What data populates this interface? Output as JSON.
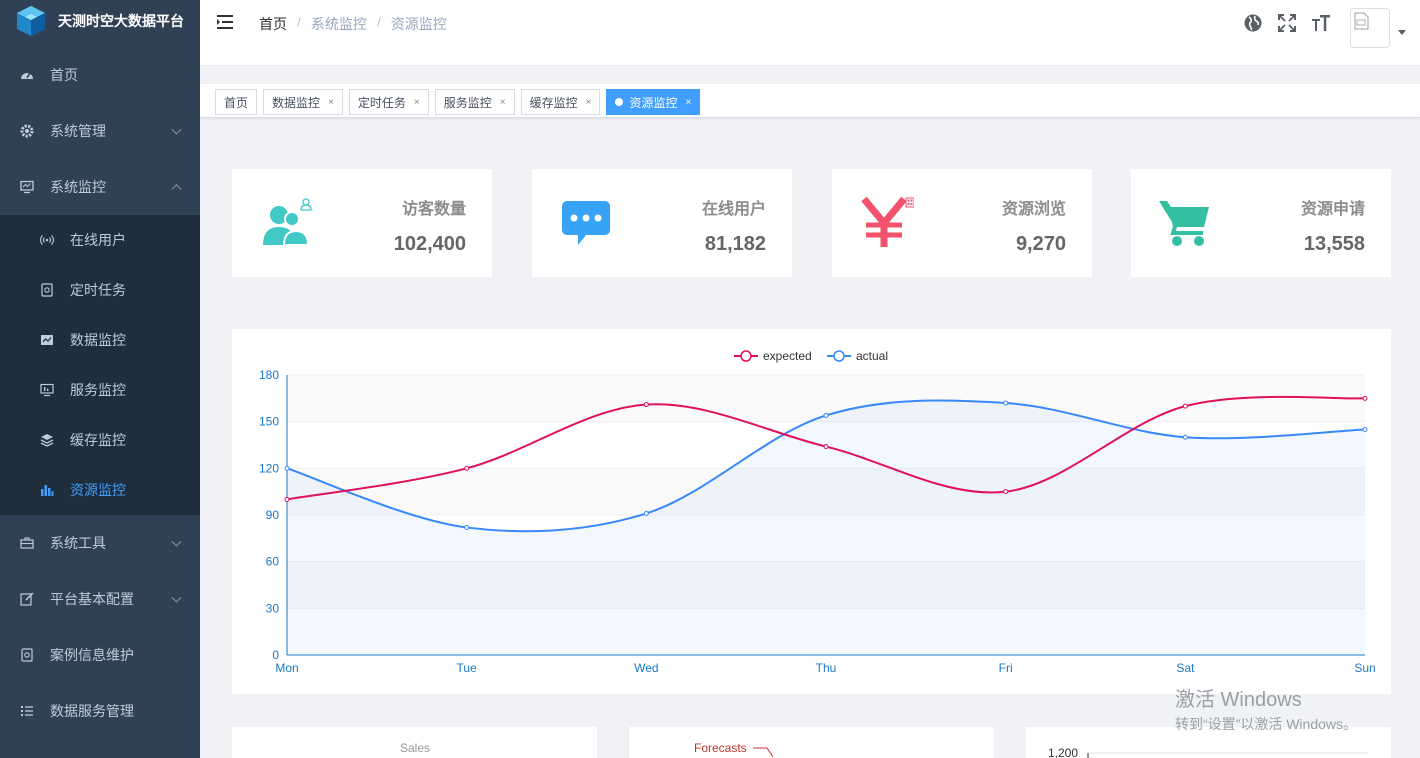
{
  "app": {
    "title": "天测时空大数据平台"
  },
  "sidebar": {
    "items": [
      {
        "label": "首页",
        "icon": "dashboard-icon"
      },
      {
        "label": "系统管理",
        "icon": "gear-icon"
      },
      {
        "label": "系统监控",
        "icon": "monitor-icon"
      },
      {
        "label": "系统工具",
        "icon": "toolbox-icon"
      },
      {
        "label": "平台基本配置",
        "icon": "edit-icon"
      },
      {
        "label": "案例信息维护",
        "icon": "case-icon"
      },
      {
        "label": "数据服务管理",
        "icon": "list-icon"
      }
    ],
    "submenu": [
      {
        "label": "在线用户",
        "icon": "online-icon"
      },
      {
        "label": "定时任务",
        "icon": "job-icon"
      },
      {
        "label": "数据监控",
        "icon": "druid-icon"
      },
      {
        "label": "服务监控",
        "icon": "server-icon"
      },
      {
        "label": "缓存监控",
        "icon": "redis-icon"
      },
      {
        "label": "资源监控",
        "icon": "chart-icon"
      }
    ]
  },
  "breadcrumb": [
    "首页",
    "系统监控",
    "资源监控"
  ],
  "tags": [
    {
      "label": "首页",
      "closable": false
    },
    {
      "label": "数据监控",
      "closable": true
    },
    {
      "label": "定时任务",
      "closable": true
    },
    {
      "label": "服务监控",
      "closable": true
    },
    {
      "label": "缓存监控",
      "closable": true
    },
    {
      "label": "资源监控",
      "closable": true,
      "active": true
    }
  ],
  "tag_close": "×",
  "panels": [
    {
      "label": "访客数量",
      "value": "102,400",
      "color": "#40c9c6"
    },
    {
      "label": "在线用户",
      "value": "81,182",
      "color": "#36a3f7"
    },
    {
      "label": "资源浏览",
      "value": "9,270",
      "color": "#f4516c"
    },
    {
      "label": "资源申请",
      "value": "13,558",
      "color": "#34bfa3"
    }
  ],
  "chart_data": {
    "type": "line",
    "categories": [
      "Mon",
      "Tue",
      "Wed",
      "Thu",
      "Fri",
      "Sat",
      "Sun"
    ],
    "series": [
      {
        "name": "expected",
        "values": [
          100,
          120,
          161,
          134,
          105,
          160,
          165
        ],
        "color": "#e0105e"
      },
      {
        "name": "actual",
        "values": [
          120,
          82,
          91,
          154,
          162,
          140,
          145
        ],
        "color": "#3888fa"
      }
    ],
    "ylim": [
      0,
      180
    ],
    "yticks": [
      0,
      30,
      60,
      90,
      120,
      150,
      180
    ],
    "legend": "top-center",
    "grid": true
  },
  "bottom": {
    "sales_label": "Sales",
    "forecasts_label": "Forecasts",
    "tick_label": "1,200"
  },
  "watermark": {
    "line1": "激活 Windows",
    "line2": "转到“设置”以激活 Windows。"
  }
}
